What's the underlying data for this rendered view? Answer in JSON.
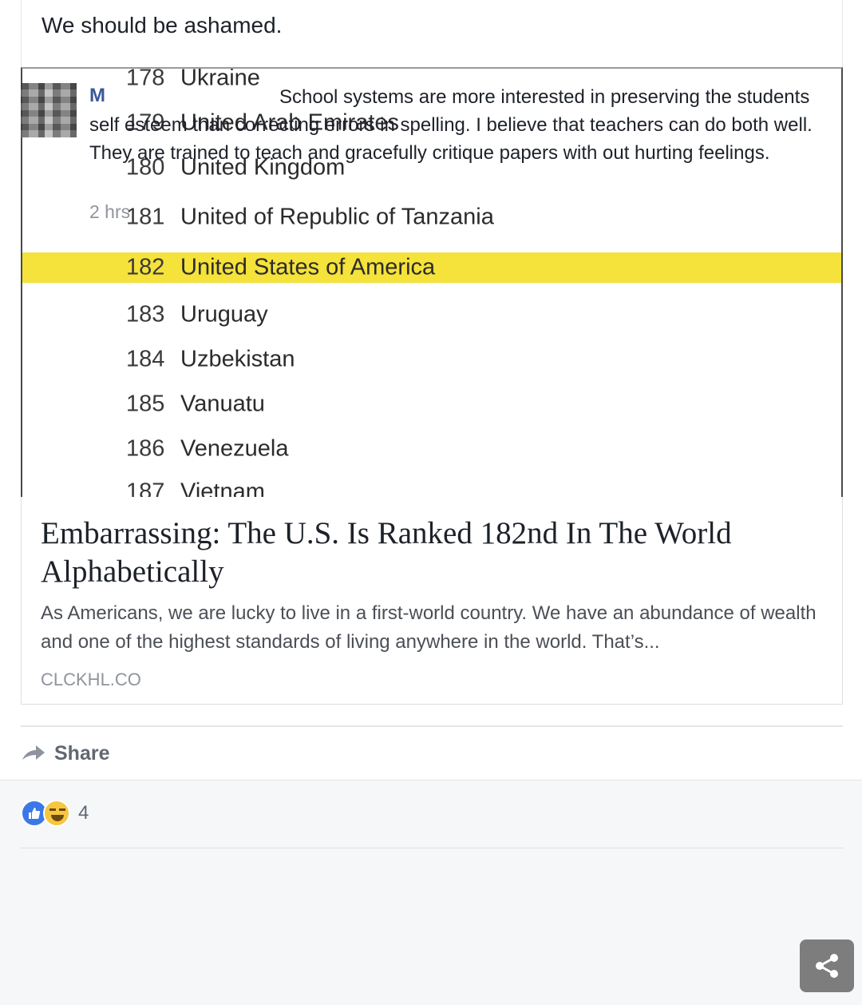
{
  "post": {
    "text": "We should be ashamed."
  },
  "ranking_list": [
    {
      "rank": "178",
      "country": "Ukraine"
    },
    {
      "rank": "179",
      "country": "United Arab Emirates"
    },
    {
      "rank": "180",
      "country": "United Kingdom"
    },
    {
      "rank": "181",
      "country": "United of Republic of Tanzania"
    },
    {
      "rank": "182",
      "country": "United States of America",
      "highlighted": true
    },
    {
      "rank": "183",
      "country": "Uruguay"
    },
    {
      "rank": "184",
      "country": "Uzbekistan"
    },
    {
      "rank": "185",
      "country": "Vanuatu"
    },
    {
      "rank": "186",
      "country": "Venezuela"
    },
    {
      "rank": "187",
      "country": "Vietnam"
    }
  ],
  "link": {
    "headline": "Embarrassing: The U.S. Is Ranked 182nd In The World Alphabetically",
    "description": "As Americans, we are lucky to live in a first-world country. We have an abundance of wealth and one of the highest standards of living anywhere in the world. That’s...",
    "domain": "CLCKHL.CO"
  },
  "actions": {
    "share_label": "Share",
    "share_icon": "share-arrow-icon"
  },
  "reactions": {
    "count": "4",
    "types": [
      "like",
      "haha"
    ]
  },
  "comment": {
    "author": "M",
    "text": "School systems are more interested in preserving the students self esteem than correcting errors in spelling. I believe that teachers can do both well. They are trained to teach and gracefully critique papers with out hurting feelings.",
    "time": "2 hrs"
  },
  "colors": {
    "highlight": "#f5e23a",
    "like_blue": "#3b78e7",
    "haha_yellow": "#f7c640",
    "author_link": "#385898"
  }
}
